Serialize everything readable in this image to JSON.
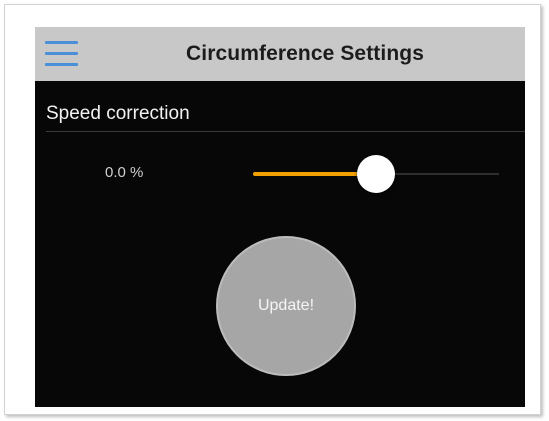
{
  "header": {
    "title": "Circumference Settings",
    "menu_icon": "hamburger-menu-icon",
    "menu_icon_color": "#4a90d9",
    "background": "#c8c8c8"
  },
  "speed_correction": {
    "label": "Speed correction",
    "value_text": "0.0 %",
    "slider": {
      "level": 0.5,
      "fill_color": "#f0a000"
    }
  },
  "update_button": {
    "label": "Update!"
  },
  "colors": {
    "screen_background": "#070707",
    "button_color": "#a6a6a6"
  }
}
